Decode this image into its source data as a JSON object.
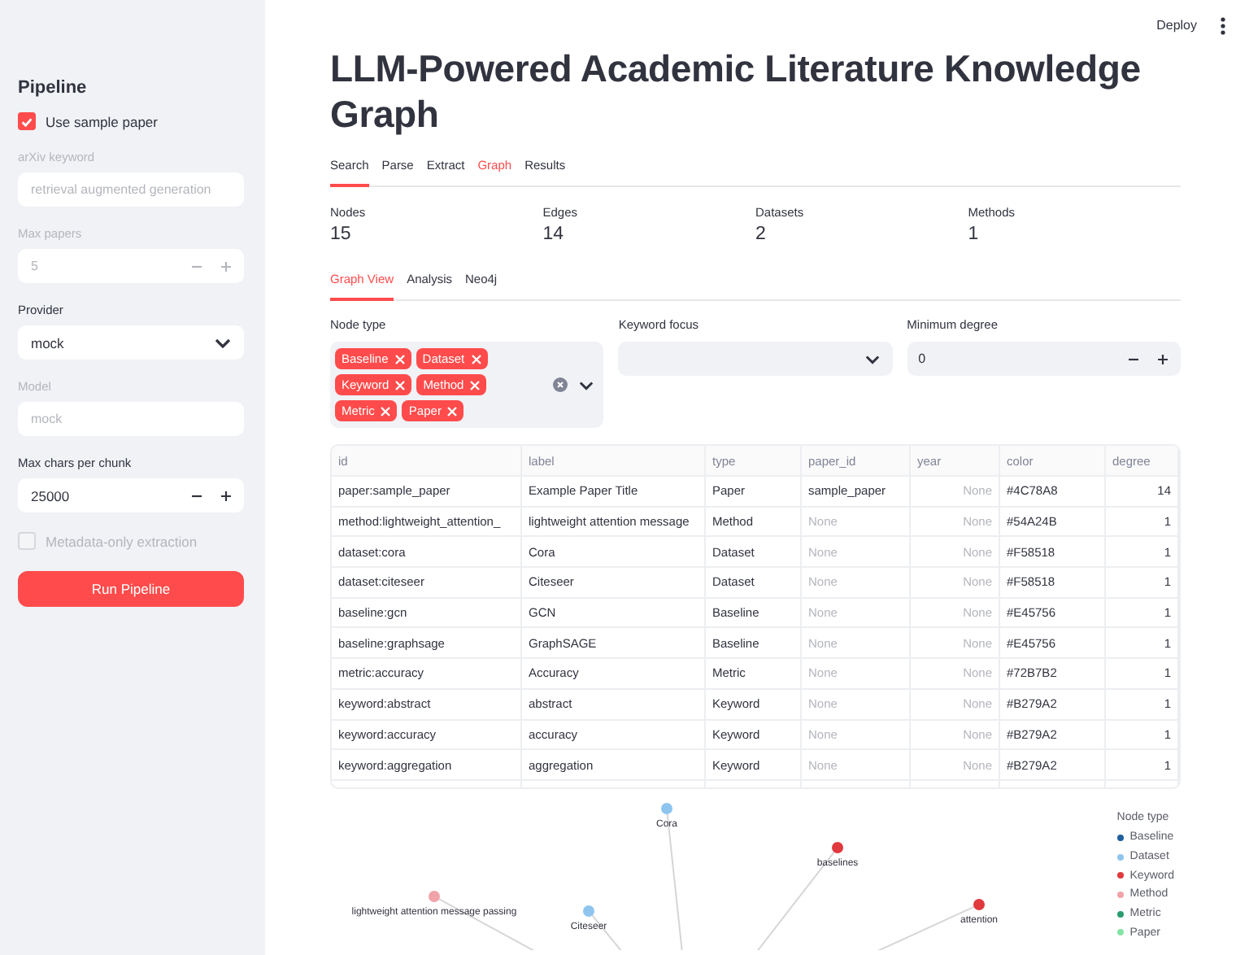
{
  "header": {
    "deploy": "Deploy"
  },
  "sidebar": {
    "title": "Pipeline",
    "controls": [
      {
        "kind": "checkbox",
        "label": "Use sample paper",
        "checked": true,
        "disabled": false
      },
      {
        "kind": "text",
        "label": "arXiv keyword",
        "value": "retrieval augmented generation",
        "disabled": true
      },
      {
        "kind": "number",
        "label": "Max papers",
        "value": "5",
        "disabled": true
      },
      {
        "kind": "select",
        "label": "Provider",
        "value": "mock",
        "disabled": false
      },
      {
        "kind": "text",
        "label": "Model",
        "value": "mock",
        "disabled": true
      },
      {
        "kind": "number",
        "label": "Max chars per chunk",
        "value": "25000",
        "disabled": false
      },
      {
        "kind": "checkbox",
        "label": "Metadata-only extraction",
        "checked": false,
        "disabled": true
      }
    ],
    "run_button": "Run Pipeline"
  },
  "title": "LLM-Powered Academic Literature Knowledge Graph",
  "tabs": [
    {
      "label": "Search",
      "selected": false,
      "underlined": true
    },
    {
      "label": "Parse",
      "selected": false,
      "underlined": false
    },
    {
      "label": "Extract",
      "selected": false,
      "underlined": false
    },
    {
      "label": "Graph",
      "selected": true,
      "underlined": false
    },
    {
      "label": "Results",
      "selected": false,
      "underlined": false
    }
  ],
  "metrics": [
    {
      "label": "Nodes",
      "value": "15"
    },
    {
      "label": "Edges",
      "value": "14"
    },
    {
      "label": "Datasets",
      "value": "2"
    },
    {
      "label": "Methods",
      "value": "1"
    }
  ],
  "subtabs": [
    {
      "label": "Graph View",
      "selected": true
    },
    {
      "label": "Analysis",
      "selected": false
    },
    {
      "label": "Neo4j",
      "selected": false
    }
  ],
  "filters": {
    "node_type": {
      "label": "Node type",
      "chips": [
        "Baseline",
        "Dataset",
        "Keyword",
        "Method",
        "Metric",
        "Paper"
      ]
    },
    "keyword_focus": {
      "label": "Keyword focus"
    },
    "minimum_degree": {
      "label": "Minimum degree",
      "value": "0"
    }
  },
  "table": {
    "columns": [
      "id",
      "label",
      "type",
      "paper_id",
      "year",
      "color",
      "degree"
    ],
    "rows": [
      [
        "paper:sample_paper",
        "Example Paper Title",
        "Paper",
        "sample_paper",
        "None",
        "#4C78A8",
        "14"
      ],
      [
        "method:lightweight_attention_",
        "lightweight attention message",
        "Method",
        "None",
        "None",
        "#54A24B",
        "1"
      ],
      [
        "dataset:cora",
        "Cora",
        "Dataset",
        "None",
        "None",
        "#F58518",
        "1"
      ],
      [
        "dataset:citeseer",
        "Citeseer",
        "Dataset",
        "None",
        "None",
        "#F58518",
        "1"
      ],
      [
        "baseline:gcn",
        "GCN",
        "Baseline",
        "None",
        "None",
        "#E45756",
        "1"
      ],
      [
        "baseline:graphsage",
        "GraphSAGE",
        "Baseline",
        "None",
        "None",
        "#E45756",
        "1"
      ],
      [
        "metric:accuracy",
        "Accuracy",
        "Metric",
        "None",
        "None",
        "#72B7B2",
        "1"
      ],
      [
        "keyword:abstract",
        "abstract",
        "Keyword",
        "None",
        "None",
        "#B279A2",
        "1"
      ],
      [
        "keyword:accuracy",
        "accuracy",
        "Keyword",
        "None",
        "None",
        "#B279A2",
        "1"
      ],
      [
        "keyword:aggregation",
        "aggregation",
        "Keyword",
        "None",
        "None",
        "#B279A2",
        "1"
      ]
    ]
  },
  "graph": {
    "nodes": [
      {
        "label": "Cora",
        "color": "#8ec5ef"
      },
      {
        "label": "baselines",
        "color": "#e0393e"
      },
      {
        "label": "lightweight attention message passing",
        "color": "#f0a3a9"
      },
      {
        "label": "Citeseer",
        "color": "#8ec5ef"
      },
      {
        "label": "attention",
        "color": "#e0393e"
      }
    ],
    "legend": {
      "title": "Node type",
      "items": [
        {
          "label": "Baseline",
          "color": "#1f5f9e"
        },
        {
          "label": "Dataset",
          "color": "#8ec5ef"
        },
        {
          "label": "Keyword",
          "color": "#e0393e"
        },
        {
          "label": "Method",
          "color": "#f0a3a9"
        },
        {
          "label": "Metric",
          "color": "#2a9d70"
        },
        {
          "label": "Paper",
          "color": "#85e3a6"
        }
      ]
    }
  }
}
